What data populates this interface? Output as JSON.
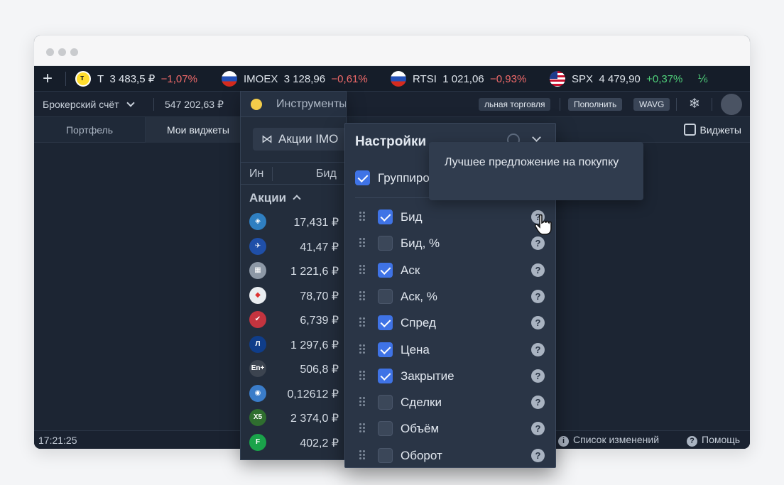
{
  "tickers": [
    {
      "symbol": "T",
      "price": "3 483,5 ₽",
      "change": "−1,07%",
      "dir": "neg",
      "icon": "tbank-icon"
    },
    {
      "symbol": "IMOEX",
      "price": "3 128,96",
      "change": "−0,61%",
      "dir": "neg",
      "icon": "russia-flag-icon"
    },
    {
      "symbol": "RTSI",
      "price": "1 021,06",
      "change": "−0,93%",
      "dir": "neg",
      "icon": "russia-flag-icon"
    },
    {
      "symbol": "SPX",
      "price": "4 479,90",
      "change": "+0,37%",
      "dir": "pos",
      "icon": "usa-flag-icon"
    }
  ],
  "ticker_overflow": "⅙",
  "account": {
    "name": "Брокерский счёт",
    "balance": "547 202,63 ₽",
    "trading_label": "льная торговля",
    "topup_label": "Пополнить",
    "wavg_label": "WAVG"
  },
  "tabs": {
    "portfolio": "Портфель",
    "my_widgets": "Мои виджеты",
    "widgets_button": "Виджеты"
  },
  "instruments": {
    "title": "Инструменты",
    "list_selector": "Акции IMO",
    "col_name": "Ин",
    "col_bid": "Бид",
    "group_label": "Акции",
    "rows": [
      {
        "price": "17,431 ₽",
        "dir": "neg",
        "logo_color": "#2f7fc1",
        "logo_text": "◈"
      },
      {
        "price": "41,47 ₽",
        "dir": "",
        "logo_color": "#1f4fa8",
        "logo_text": "✈"
      },
      {
        "price": "1 221,6 ₽",
        "dir": "pos",
        "logo_color": "#8d98a6",
        "logo_text": "▦"
      },
      {
        "price": "78,70 ₽",
        "dir": "",
        "logo_color": "#e9edf1",
        "logo_text": "◆"
      },
      {
        "price": "6,739 ₽",
        "dir": "",
        "logo_color": "#c4343f",
        "logo_text": "✔"
      },
      {
        "price": "1 297,6 ₽",
        "dir": "",
        "logo_color": "#0f3d8a",
        "logo_text": "Л"
      },
      {
        "price": "506,8 ₽",
        "dir": "",
        "logo_color": "#3c4450",
        "logo_text": "En+"
      },
      {
        "price": "0,12612 ₽",
        "dir": "",
        "logo_color": "#3a7cc9",
        "logo_text": "◉"
      },
      {
        "price": "2 374,0 ₽",
        "dir": "",
        "logo_color": "#2f6e2f",
        "logo_text": "X5"
      },
      {
        "price": "402,2 ₽",
        "dir": "",
        "logo_color": "#1aa34a",
        "logo_text": "F"
      }
    ]
  },
  "settings": {
    "title": "Настройки",
    "group_label": "Группиро",
    "items": [
      {
        "label": "Бид",
        "checked": true
      },
      {
        "label": "Бид, %",
        "checked": false
      },
      {
        "label": "Аск",
        "checked": true
      },
      {
        "label": "Аск, %",
        "checked": false
      },
      {
        "label": "Спред",
        "checked": true
      },
      {
        "label": "Цена",
        "checked": true
      },
      {
        "label": "Закрытие",
        "checked": true
      },
      {
        "label": "Сделки",
        "checked": false
      },
      {
        "label": "Объём",
        "checked": false
      },
      {
        "label": "Оборот",
        "checked": false
      }
    ]
  },
  "tooltip": "Лучшее предложение на покупку",
  "footer": {
    "time": "17:21:25",
    "changelog": "Список изменений",
    "help": "Помощь"
  }
}
